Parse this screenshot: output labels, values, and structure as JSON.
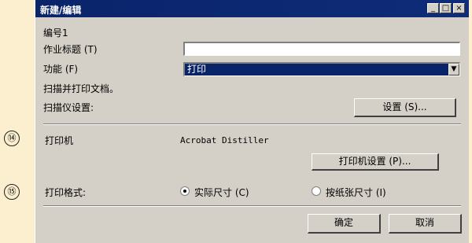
{
  "callouts": {
    "c14": "⑭",
    "c15": "⑮"
  },
  "window": {
    "title": "新建/编辑",
    "controls": {
      "minimize": "_",
      "maximize": "□",
      "close": "×"
    }
  },
  "form": {
    "id_label": "编号1",
    "job_title_label": "作业标题 (T)",
    "job_title_value": "",
    "function_label": "功能 (F)",
    "function_value": "打印",
    "description": "扫描并打印文档。",
    "scanner_settings_label": "扫描仪设置:",
    "settings_button": "设置 (S)...",
    "printer_label": "打印机",
    "printer_name": "Acrobat Distiller",
    "printer_settings_button": "打印机设置 (P)...",
    "print_format_label": "打印格式:",
    "radio_actual": "实际尺寸 (C)",
    "radio_fit": "按纸张尺寸 (I)",
    "selected": "actual"
  },
  "footer": {
    "ok_button": "确定",
    "cancel_button": "取消"
  }
}
